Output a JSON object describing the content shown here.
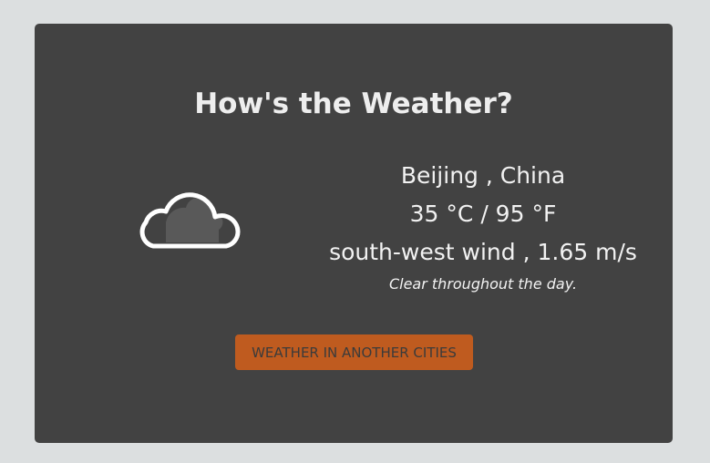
{
  "title": "How's the Weather?",
  "weather": {
    "icon": "cloud-icon",
    "location": "Beijing , China",
    "temperature": "35 °C / 95 °F",
    "wind": "south-west wind , 1.65 m/s",
    "description": "Clear throughout the day."
  },
  "button": {
    "label": "WEATHER IN ANOTHER CITIES"
  },
  "colors": {
    "page_background": "#dcdfe0",
    "card_background": "#424242",
    "text": "#f2f2f2",
    "button_background": "#bf5b1f",
    "button_text": "#3b3b3b"
  }
}
